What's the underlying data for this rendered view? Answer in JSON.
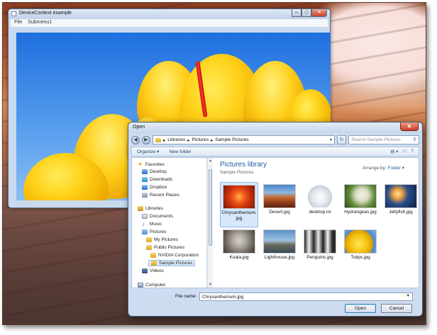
{
  "app_window": {
    "title": "DeviceContext example",
    "menu": [
      "File",
      "Submenu1"
    ],
    "caption_buttons": {
      "minimize": "–",
      "maximize": "□",
      "close": "✕"
    }
  },
  "dialog": {
    "title": "Open",
    "close": "✕",
    "address": {
      "back": "◀",
      "forward": "▶",
      "crumbs": [
        "Libraries",
        "Pictures",
        "Sample Pictures"
      ],
      "separator": "▸",
      "dropdown": "▾",
      "refresh": "↻",
      "search_placeholder": "Search Sample Pictures",
      "search_icon": "search-icon"
    },
    "toolbar": {
      "organize": "Organize ▾",
      "new_folder": "New folder",
      "view": "▤ ▾",
      "pane": "□",
      "help": "?"
    },
    "nav": {
      "favorites": "Favorites",
      "desktop": "Desktop",
      "downloads": "Downloads",
      "dropbox": "Dropbox",
      "recent": "Recent Places",
      "libraries": "Libraries",
      "documents": "Documents",
      "music": "Music",
      "pictures": "Pictures",
      "my_pictures": "My Pictures",
      "public_pictures": "Public Pictures",
      "nvidia": "NVIDIA Corporation",
      "sample": "Sample Pictures",
      "videos": "Videos",
      "computer": "Computer"
    },
    "library": {
      "title": "Pictures library",
      "subtitle": "Sample Pictures",
      "arrange_label": "Arrange by:",
      "arrange_value": "Folder ▾"
    },
    "files": [
      {
        "name": "Chrysanthemum.jpg",
        "line1": "Chrysanthemum.",
        "line2": "jpg",
        "selected": true
      },
      {
        "name": "Desert.jpg"
      },
      {
        "name": "desktop.ini"
      },
      {
        "name": "Hydrangeas.jpg"
      },
      {
        "name": "Jellyfish.jpg"
      },
      {
        "name": "Koala.jpg"
      },
      {
        "name": "Lighthouse.jpg"
      },
      {
        "name": "Penguins.jpg"
      },
      {
        "name": "Tulips.jpg"
      }
    ],
    "file_name_label": "File name:",
    "file_name_value": "Chrysanthemum.jpg",
    "open_label": "Open",
    "cancel_label": "Cancel"
  }
}
